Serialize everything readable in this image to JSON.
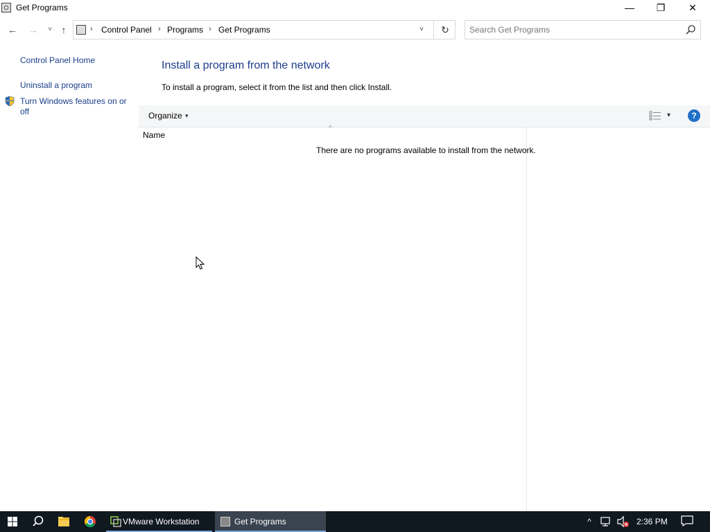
{
  "window": {
    "title": "Get Programs",
    "minimize": "—",
    "maximize": "❐",
    "close": "✕"
  },
  "nav": {
    "back": "←",
    "forward": "→",
    "recent": "˅",
    "up": "↑",
    "breadcrumbs": [
      "Control Panel",
      "Programs",
      "Get Programs"
    ],
    "separator": "›",
    "address_dropdown": "˅",
    "refresh": "↻"
  },
  "search": {
    "placeholder": "Search Get Programs",
    "value": ""
  },
  "sidebar": {
    "home": "Control Panel Home",
    "uninstall": "Uninstall a program",
    "features_line1": "Turn Windows features on or",
    "features_line2": "off"
  },
  "main": {
    "heading": "Install a program from the network",
    "instructions": "To install a program, select it from the list and then click Install.",
    "organize": "Organize",
    "organize_caret": "▾",
    "view_caret": "▾",
    "help": "?",
    "sort_indicator": "^",
    "column_name": "Name",
    "empty_message": "There are no programs available to install from the network."
  },
  "taskbar": {
    "tasks": [
      {
        "label": "VMware Workstation"
      },
      {
        "label": "Get Programs"
      }
    ],
    "tray_chevron": "^",
    "clock": "2:36 PM"
  },
  "colors": {
    "link": "#1a3e8a",
    "heading": "#1e3c8c",
    "taskbar": "#101820",
    "accent": "#1f6fc8"
  }
}
